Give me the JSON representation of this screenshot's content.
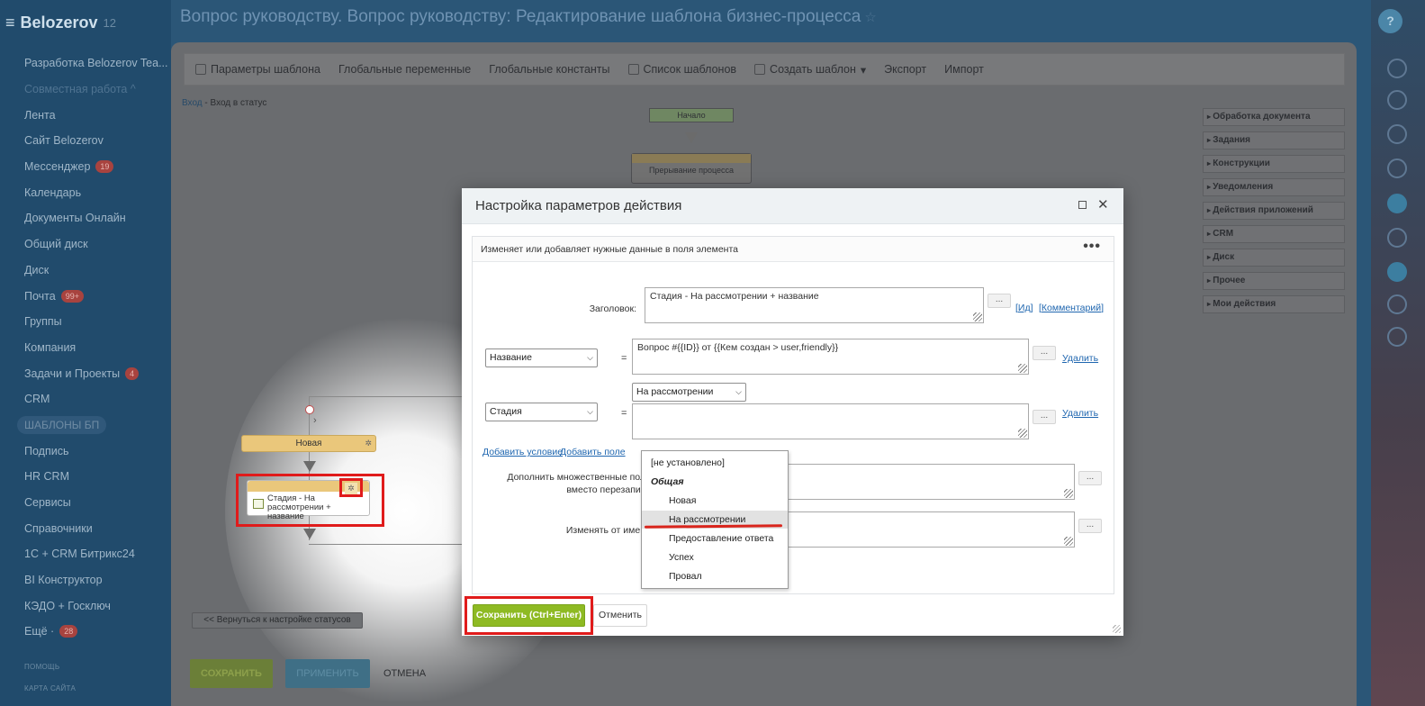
{
  "sidebar": {
    "logo": "Belozerov",
    "logo_sub": "12",
    "items": [
      {
        "label": "Разработка Belozerov Tea...",
        "badge": ""
      },
      {
        "label": "Совместная работа ^",
        "badge": ""
      },
      {
        "label": "Лента",
        "badge": ""
      },
      {
        "label": "Сайт Belozerov",
        "badge": ""
      },
      {
        "label": "Мессенджер",
        "badge": "19"
      },
      {
        "label": "Календарь",
        "badge": ""
      },
      {
        "label": "Документы Онлайн",
        "badge": ""
      },
      {
        "label": "Общий диск",
        "badge": ""
      },
      {
        "label": "Диск",
        "badge": ""
      },
      {
        "label": "Почта",
        "badge": "99+"
      },
      {
        "label": "Группы",
        "badge": ""
      },
      {
        "label": "Компания",
        "badge": ""
      },
      {
        "label": "Задачи и Проекты",
        "badge": "4"
      },
      {
        "label": "CRM",
        "badge": ""
      },
      {
        "label": "ШАБЛОНЫ БП",
        "badge": ""
      },
      {
        "label": "Подпись",
        "badge": ""
      },
      {
        "label": "HR CRM",
        "badge": ""
      },
      {
        "label": "Сервисы",
        "badge": ""
      },
      {
        "label": "Справочники",
        "badge": ""
      },
      {
        "label": "1С + CRM Битрикс24",
        "badge": ""
      },
      {
        "label": "BI Конструктор",
        "badge": ""
      },
      {
        "label": "КЭДО + Госключ",
        "badge": ""
      },
      {
        "label": "Ещё ·",
        "badge": "28"
      }
    ],
    "footer_help": "ПОМОЩЬ",
    "footer_map": "КАРТА САЙТА"
  },
  "header": {
    "title": "Вопрос руководству. Вопрос руководству: Редактирование шаблона бизнес-процесса"
  },
  "toolbar": {
    "items": [
      "Параметры шаблона",
      "Глобальные переменные",
      "Глобальные константы",
      "Список шаблонов",
      "Создать шаблон",
      "Экспорт",
      "Импорт"
    ]
  },
  "breadcrumbs": {
    "link": "Вход",
    "sep": " - ",
    "current": "Вход в статус"
  },
  "canvas": {
    "start": "Начало",
    "interrupt": "Прерывание процесса",
    "node_new": "Новая",
    "action_label": "Стадия - На рассмотрении + название"
  },
  "right_panel": [
    "Обработка документа",
    "Задания",
    "Конструкции",
    "Уведомления",
    "Действия приложений",
    "CRM",
    "Диск",
    "Прочее",
    "Мои действия"
  ],
  "bottom": {
    "back": "<< Вернуться к настройке статусов",
    "save": "СОХРАНИТЬ",
    "apply": "ПРИМЕНИТЬ",
    "cancel": "ОТМЕНА"
  },
  "dialog": {
    "title": "Настройка параметров действия",
    "description": "Изменяет или добавляет нужные данные в поля элемента",
    "header_label": "Заголовок:",
    "header_value": "Стадия - На рассмотрении + название",
    "link_id": "Ид",
    "link_comment": "Комментарий",
    "field1_select": "Название",
    "field1_value": "Вопрос #{{ID}} от {{Кем создан > user,friendly}}",
    "field2_select": "Стадия",
    "field2_value_select": "На рассмотрении",
    "delete_link": "Удалить",
    "add_condition": "Добавить условие",
    "add_field": "Добавить поле",
    "merge_label_1": "Дополнить множественные пол",
    "merge_label_2": "вместо перезапис",
    "change_name_label": "Изменять от имен",
    "dots": "...",
    "eq": "=",
    "dropdown": {
      "options": [
        "[не установлено]",
        "Общая",
        "Новая",
        "На рассмотрении",
        "Предоставление ответа",
        "Успех",
        "Провал"
      ],
      "selected": "На рассмотрении"
    },
    "save_btn": "Сохранить (Ctrl+Enter)",
    "cancel_btn": "Отменить"
  },
  "colors": {
    "accent_green": "#8eba23",
    "highlight_red": "#e01b1b",
    "link_blue": "#2067b0"
  }
}
